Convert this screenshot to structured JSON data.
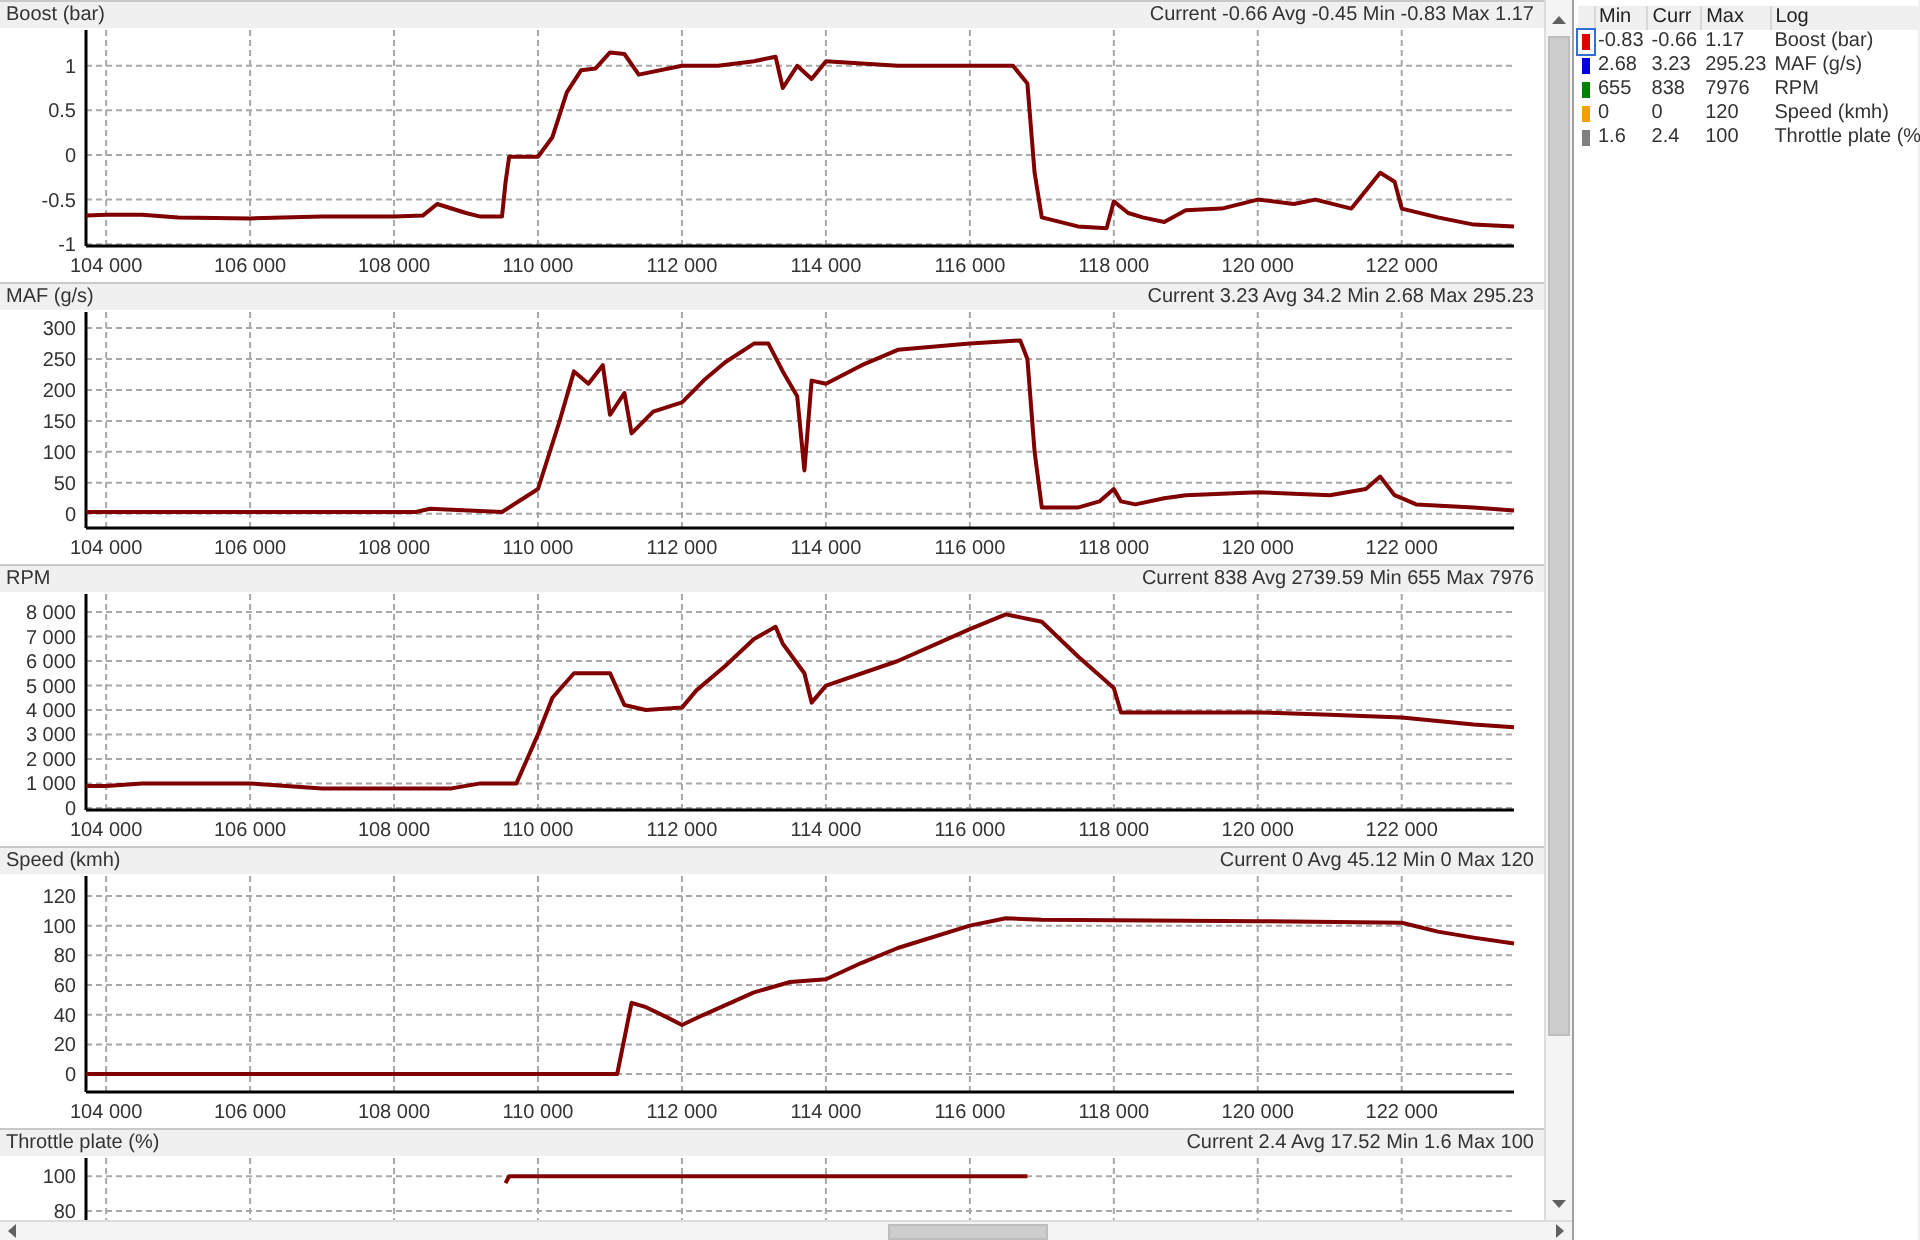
{
  "panes": [
    {
      "title": "Boost (bar)",
      "stats": "Current -0.66 Avg -0.45 Min -0.83 Max 1.17",
      "chart_data": {
        "type": "line",
        "xlim": [
          103720,
          123560
        ],
        "ylim": [
          -1.02,
          1.4
        ],
        "xticks": [
          {
            "value": 104000,
            "label": "104 000"
          },
          {
            "value": 106000,
            "label": "106 000"
          },
          {
            "value": 108000,
            "label": "108 000"
          },
          {
            "value": 110000,
            "label": "110 000"
          },
          {
            "value": 112000,
            "label": "112 000"
          },
          {
            "value": 114000,
            "label": "114 000"
          },
          {
            "value": 116000,
            "label": "116 000"
          },
          {
            "value": 118000,
            "label": "118 000"
          },
          {
            "value": 120000,
            "label": "120 000"
          },
          {
            "value": 122000,
            "label": "122 000"
          }
        ],
        "yticks": [
          -1,
          -0.5,
          0,
          0.5,
          1
        ],
        "x": [
          103720,
          104000,
          104500,
          105000,
          106000,
          107000,
          108000,
          108400,
          108600,
          109000,
          109200,
          109500,
          109550,
          109600,
          110000,
          110200,
          110400,
          110600,
          110800,
          111000,
          111200,
          111400,
          112000,
          112500,
          113000,
          113300,
          113400,
          113600,
          113800,
          114000,
          115000,
          116000,
          116600,
          116800,
          116900,
          117000,
          117500,
          117900,
          118000,
          118200,
          118400,
          118700,
          119000,
          119500,
          120000,
          120500,
          120800,
          121300,
          121700,
          121900,
          122000,
          122500,
          123000,
          123560
        ],
        "grid": true,
        "series": [
          {
            "color": "#800000",
            "values": [
              -0.68,
              -0.67,
              -0.67,
              -0.7,
              -0.71,
              -0.69,
              -0.69,
              -0.68,
              -0.55,
              -0.65,
              -0.69,
              -0.69,
              -0.3,
              -0.02,
              -0.02,
              0.2,
              0.7,
              0.95,
              0.97,
              1.15,
              1.13,
              0.9,
              1.0,
              1.0,
              1.05,
              1.1,
              0.75,
              1.0,
              0.85,
              1.05,
              1.0,
              1.0,
              1.0,
              0.8,
              -0.2,
              -0.7,
              -0.8,
              -0.82,
              -0.52,
              -0.65,
              -0.7,
              -0.75,
              -0.62,
              -0.6,
              -0.5,
              -0.55,
              -0.5,
              -0.6,
              -0.2,
              -0.3,
              -0.6,
              -0.7,
              -0.78,
              -0.8
            ]
          }
        ]
      }
    },
    {
      "title": "MAF (g/s)",
      "stats": "Current 3.23 Avg 34.2 Min 2.68 Max 295.23",
      "chart_data": {
        "type": "line",
        "xlim": [
          103720,
          123560
        ],
        "ylim": [
          -23,
          326
        ],
        "xticks": [
          {
            "value": 104000,
            "label": "104 000"
          },
          {
            "value": 106000,
            "label": "106 000"
          },
          {
            "value": 108000,
            "label": "108 000"
          },
          {
            "value": 110000,
            "label": "110 000"
          },
          {
            "value": 112000,
            "label": "112 000"
          },
          {
            "value": 114000,
            "label": "114 000"
          },
          {
            "value": 116000,
            "label": "116 000"
          },
          {
            "value": 118000,
            "label": "118 000"
          },
          {
            "value": 120000,
            "label": "120 000"
          },
          {
            "value": 122000,
            "label": "122 000"
          }
        ],
        "yticks": [
          0,
          50,
          100,
          150,
          200,
          250,
          300
        ],
        "x": [
          103720,
          105000,
          107000,
          108300,
          108500,
          109500,
          110000,
          110300,
          110500,
          110700,
          110900,
          111000,
          111200,
          111300,
          111600,
          112000,
          112300,
          112600,
          113000,
          113200,
          113400,
          113600,
          113700,
          113800,
          114000,
          114500,
          115000,
          116000,
          116700,
          116800,
          116900,
          117000,
          117500,
          117800,
          118000,
          118100,
          118300,
          118700,
          119000,
          120000,
          121000,
          121500,
          121700,
          121900,
          122200,
          123000,
          123560
        ],
        "grid": true,
        "series": [
          {
            "color": "#800000",
            "values": [
              3,
              3,
              3,
              3,
              8,
              3,
              40,
              150,
              230,
              210,
              240,
              160,
              195,
              130,
              165,
              180,
              215,
              245,
              275,
              275,
              230,
              190,
              70,
              215,
              210,
              240,
              265,
              275,
              280,
              250,
              100,
              10,
              10,
              20,
              40,
              20,
              15,
              25,
              30,
              35,
              30,
              40,
              60,
              30,
              15,
              10,
              5
            ]
          }
        ]
      }
    },
    {
      "title": "RPM",
      "stats": "Current 838 Avg 2739.59 Min 655 Max 7976",
      "chart_data": {
        "type": "line",
        "xlim": [
          103720,
          123560
        ],
        "ylim": [
          -82,
          8735
        ],
        "xticks": [
          {
            "value": 104000,
            "label": "104 000"
          },
          {
            "value": 106000,
            "label": "106 000"
          },
          {
            "value": 108000,
            "label": "108 000"
          },
          {
            "value": 110000,
            "label": "110 000"
          },
          {
            "value": 112000,
            "label": "112 000"
          },
          {
            "value": 114000,
            "label": "114 000"
          },
          {
            "value": 116000,
            "label": "116 000"
          },
          {
            "value": 118000,
            "label": "118 000"
          },
          {
            "value": 120000,
            "label": "120 000"
          },
          {
            "value": 122000,
            "label": "122 000"
          }
        ],
        "yticks": [
          0,
          {
            "value": 1000,
            "label": "1 000"
          },
          {
            "value": 2000,
            "label": "2 000"
          },
          {
            "value": 3000,
            "label": "3 000"
          },
          {
            "value": 4000,
            "label": "4 000"
          },
          {
            "value": 5000,
            "label": "5 000"
          },
          {
            "value": 6000,
            "label": "6 000"
          },
          {
            "value": 7000,
            "label": "7 000"
          },
          {
            "value": 8000,
            "label": "8 000"
          }
        ],
        "x": [
          103720,
          104000,
          104500,
          106000,
          107000,
          108000,
          108800,
          109200,
          109600,
          109700,
          110000,
          110200,
          110500,
          111000,
          111200,
          111500,
          112000,
          112200,
          112600,
          113000,
          113300,
          113400,
          113700,
          113800,
          114000,
          115000,
          116000,
          116500,
          117000,
          117500,
          118000,
          118100,
          119000,
          120000,
          121000,
          122000,
          123000,
          123560
        ],
        "grid": true,
        "series": [
          {
            "color": "#800000",
            "values": [
              900,
              900,
              1000,
              1000,
              800,
              800,
              800,
              1000,
              1000,
              1000,
              3000,
              4500,
              5500,
              5500,
              4200,
              4000,
              4100,
              4800,
              5800,
              6900,
              7400,
              6700,
              5500,
              4300,
              5000,
              6000,
              7300,
              7900,
              7600,
              6200,
              4900,
              3900,
              3900,
              3900,
              3800,
              3700,
              3400,
              3300
            ]
          }
        ]
      }
    },
    {
      "title": "Speed (kmh)",
      "stats": "Current 0 Avg 45.12 Min 0 Max 120",
      "chart_data": {
        "type": "line",
        "xlim": [
          103720,
          123560
        ],
        "ylim": [
          -12.1,
          133.5
        ],
        "xticks": [
          {
            "value": 104000,
            "label": "104 000"
          },
          {
            "value": 106000,
            "label": "106 000"
          },
          {
            "value": 108000,
            "label": "108 000"
          },
          {
            "value": 110000,
            "label": "110 000"
          },
          {
            "value": 112000,
            "label": "112 000"
          },
          {
            "value": 114000,
            "label": "114 000"
          },
          {
            "value": 116000,
            "label": "116 000"
          },
          {
            "value": 118000,
            "label": "118 000"
          },
          {
            "value": 120000,
            "label": "120 000"
          },
          {
            "value": 122000,
            "label": "122 000"
          }
        ],
        "yticks": [
          0,
          20,
          40,
          60,
          80,
          100,
          120
        ],
        "x": [
          103720,
          111100,
          111300,
          111500,
          111800,
          112000,
          112300,
          113000,
          113500,
          114000,
          114500,
          115000,
          116000,
          116500,
          117000,
          120000,
          122000,
          122500,
          123000,
          123560
        ],
        "grid": true,
        "series": [
          {
            "color": "#800000",
            "values": [
              0,
              0,
              48,
              45,
              38,
              33,
              40,
              55,
              62,
              64,
              75,
              85,
              100,
              105,
              104,
              103,
              102,
              96,
              92,
              88
            ]
          }
        ]
      }
    },
    {
      "title": "Throttle plate (%)",
      "stats": "Current 2.4 Avg 17.52 Min 1.6 Max 100",
      "chart_data": {
        "type": "line",
        "xlim": [
          103720,
          123560
        ],
        "ylim": [
          -13.7,
          110.5
        ],
        "yticks": [
          80,
          100
        ],
        "x": [
          109550,
          109600,
          116800
        ],
        "grid": true,
        "series": [
          {
            "color": "#800000",
            "values": [
              96,
              100,
              100
            ]
          }
        ]
      }
    }
  ],
  "legend": {
    "columns": [
      "Min",
      "Curr",
      "Max",
      "Log"
    ],
    "rows": [
      {
        "color": "#e00000",
        "min": "-0.83",
        "curr": "-0.66",
        "max": "1.17",
        "log": "Boost (bar)",
        "selected": true
      },
      {
        "color": "#0000e0",
        "min": "2.68",
        "curr": "3.23",
        "max": "295.23",
        "log": "MAF (g/s)",
        "selected": false
      },
      {
        "color": "#008000",
        "min": "655",
        "curr": "838",
        "max": "7976",
        "log": "RPM",
        "selected": false
      },
      {
        "color": "#f0a000",
        "min": "0",
        "curr": "0",
        "max": "120",
        "log": "Speed (kmh)",
        "selected": false
      },
      {
        "color": "#808080",
        "min": "1.6",
        "curr": "2.4",
        "max": "100",
        "log": "Throttle plate (%",
        "selected": false
      }
    ]
  }
}
